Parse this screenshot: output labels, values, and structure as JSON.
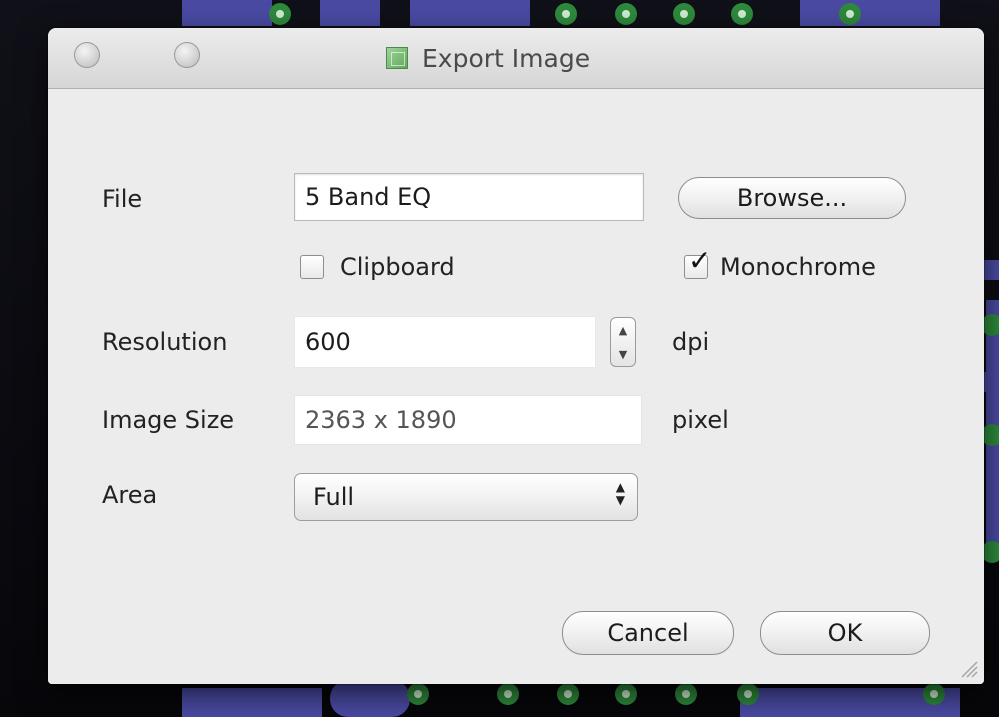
{
  "window": {
    "title": "Export Image"
  },
  "form": {
    "file_label": "File",
    "file_value": "5 Band EQ",
    "browse_label": "Browse...",
    "clipboard_label": "Clipboard",
    "clipboard_checked": false,
    "monochrome_label": "Monochrome",
    "monochrome_checked": true,
    "resolution_label": "Resolution",
    "resolution_value": "600",
    "resolution_unit": "dpi",
    "image_size_label": "Image Size",
    "image_size_value": "2363 x 1890",
    "image_size_unit": "pixel",
    "area_label": "Area",
    "area_value": "Full"
  },
  "buttons": {
    "cancel_label": "Cancel",
    "ok_label": "OK"
  },
  "colors": {
    "pcb_board": "#4a4aa3",
    "pcb_pad_ring": "#2e8a3c",
    "pcb_pad_center": "#cfeccf"
  }
}
